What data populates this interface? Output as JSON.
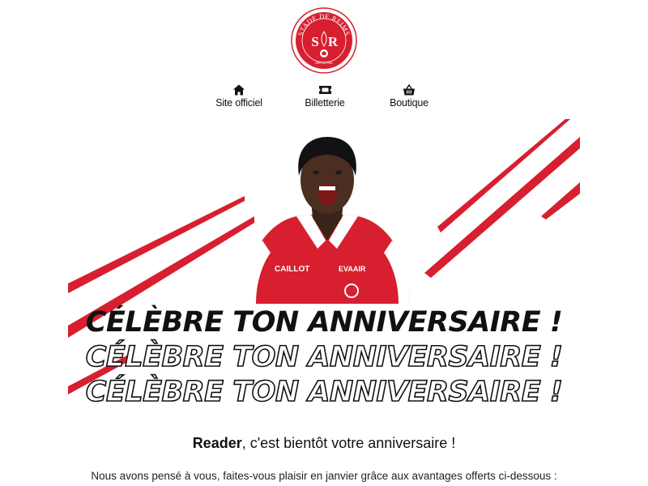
{
  "logo": {
    "club_name": "STADE DE REIMS",
    "monogram_left": "S",
    "monogram_right": "R",
    "founded": "DEPUIS 1931",
    "brand_color": "#d71f2f"
  },
  "nav": {
    "items": [
      {
        "label": "Site officiel",
        "icon": "home-icon"
      },
      {
        "label": "Billetterie",
        "icon": "ticket-icon"
      },
      {
        "label": "Boutique",
        "icon": "basket-icon"
      }
    ]
  },
  "hero": {
    "accent_color": "#d71f2f",
    "jersey_sponsor_left": "CAILLOT",
    "jersey_sponsor_right": "EVAAIR",
    "headline_lines": [
      "CÉLÈBRE TON ANNIVERSAIRE !",
      "CÉLÈBRE TON ANNIVERSAIRE !",
      "CÉLÈBRE TON ANNIVERSAIRE !"
    ]
  },
  "message": {
    "name": "Reader",
    "greeting_rest": ", c'est bientôt votre anniversaire !",
    "intro": "Nous avons pensé à vous, faites-vous plaisir en janvier grâce aux avantages offerts ci-dessous :"
  }
}
